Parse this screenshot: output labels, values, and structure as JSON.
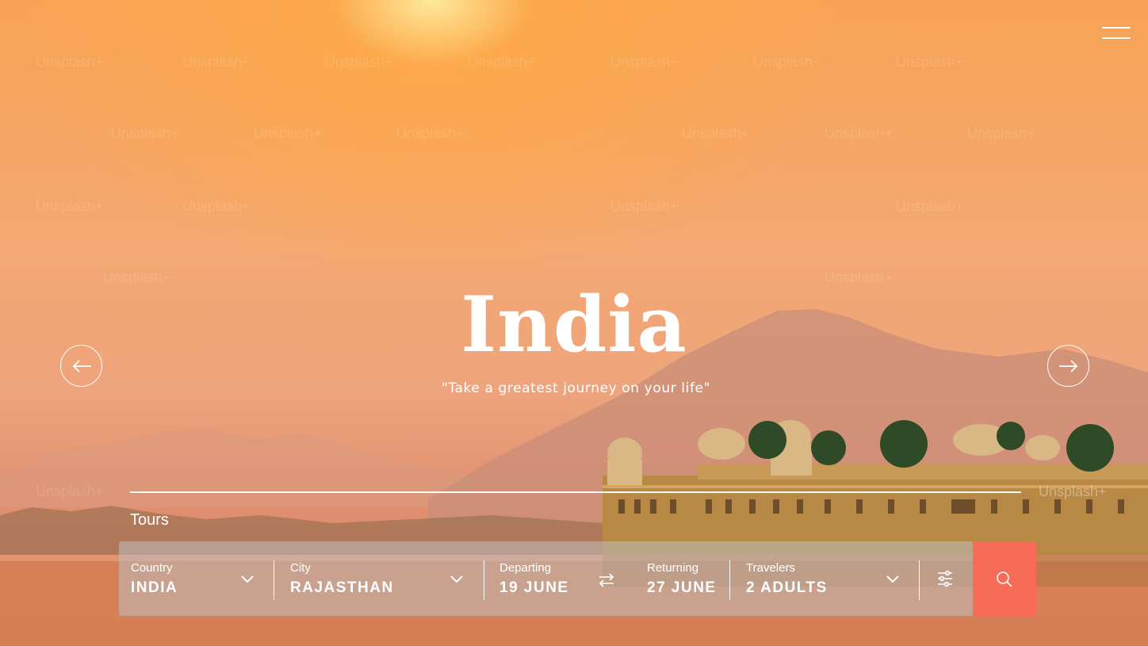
{
  "hero": {
    "title": "India",
    "tagline": "\"Take a greatest journey on your life\"",
    "watermark_text": "Unsplash+"
  },
  "nav": {
    "menu_icon": "hamburger-menu-icon",
    "prev_icon": "arrow-left-icon",
    "next_icon": "arrow-right-icon"
  },
  "tabs": [
    {
      "label": "Tours",
      "active": true
    }
  ],
  "search": {
    "country": {
      "label": "Country",
      "value": "INDIA"
    },
    "city": {
      "label": "City",
      "value": "RAJASTHAN"
    },
    "departing": {
      "label": "Departing",
      "value": "19 JUNE"
    },
    "returning": {
      "label": "Returning",
      "value": "27 JUNE"
    },
    "travelers": {
      "label": "Travelers",
      "value": "2 ADULTS"
    },
    "swap_icon": "swap-arrows-icon",
    "filters_icon": "sliders-icon",
    "search_icon": "search-icon"
  },
  "colors": {
    "accent": "#f86b56",
    "text": "#ffffff"
  }
}
